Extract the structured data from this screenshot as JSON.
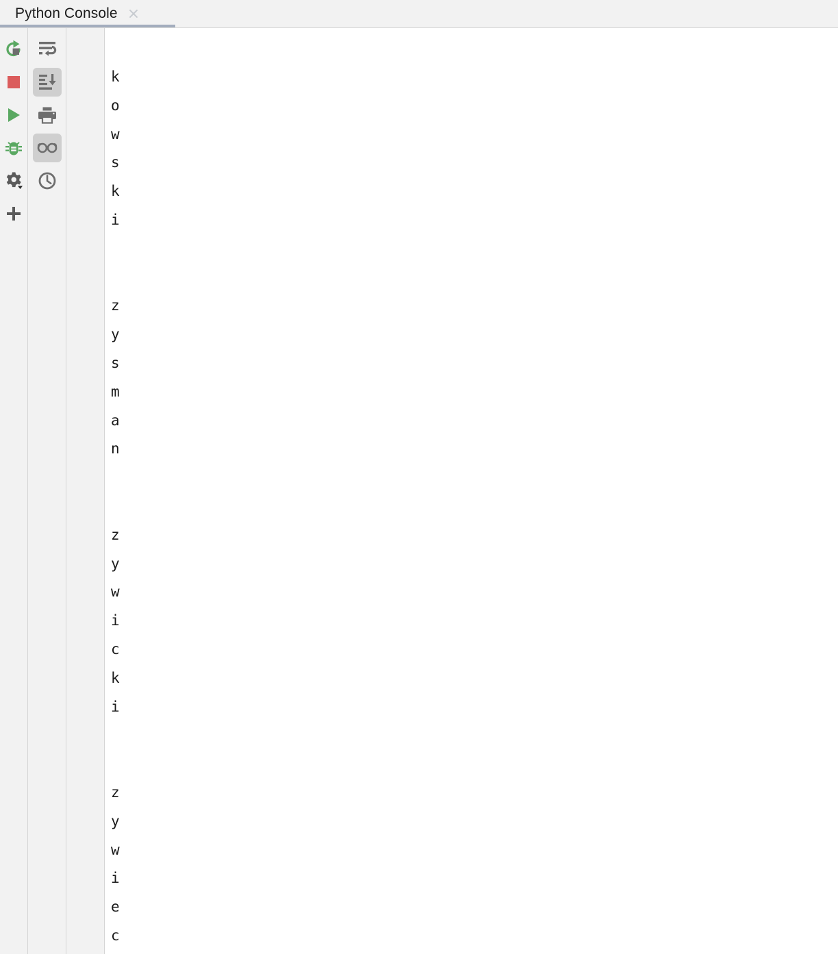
{
  "window": {
    "tab": {
      "title": "Python Console",
      "close_label": "×",
      "close_icon": "close-icon",
      "active": true,
      "underline_color": "#a3adbd"
    },
    "background": "#ffffff",
    "chrome_color": "#f2f2f2",
    "divider_color": "#d4d4d4"
  },
  "left_toolbar": {
    "buttons": [
      {
        "name": "rerun",
        "label": "Rerun Console",
        "icon": "rerun-icon",
        "color": "#59a861",
        "selected": false
      },
      {
        "name": "stop",
        "label": "Stop Console",
        "icon": "stop-square-icon",
        "color": "#db5c5c",
        "selected": false
      },
      {
        "name": "execute",
        "label": "Execute Current Statement",
        "icon": "play-triangle-icon",
        "color": "#59a861",
        "selected": false
      },
      {
        "name": "debug",
        "label": "Attach Debugger",
        "icon": "bug-icon",
        "color": "#59a861",
        "selected": false
      },
      {
        "name": "settings",
        "label": "Settings",
        "icon": "gear-icon",
        "color": "#5a5a5a",
        "selected": false
      },
      {
        "name": "new-console",
        "label": "New Console",
        "icon": "plus-icon",
        "color": "#5a5a5a",
        "selected": false
      }
    ]
  },
  "right_toolbar": {
    "buttons": [
      {
        "name": "soft-wrap",
        "label": "Use Soft Wraps",
        "icon": "soft-wrap-icon",
        "color": "#6e6e6e",
        "selected": false
      },
      {
        "name": "scroll-to-end",
        "label": "Scroll to the End",
        "icon": "scroll-to-end-icon",
        "color": "#6e6e6e",
        "selected": true
      },
      {
        "name": "print",
        "label": "Print",
        "icon": "printer-icon",
        "color": "#6e6e6e",
        "selected": false
      },
      {
        "name": "read-only",
        "label": "Toggle Read-Only Mode",
        "icon": "glasses-icon",
        "color": "#6e6e6e",
        "selected": true
      },
      {
        "name": "history",
        "label": "Show History",
        "icon": "clock-icon",
        "color": "#6e6e6e",
        "selected": false
      }
    ]
  },
  "console": {
    "output": "k\no\nw\ns\nk\ni\n\n\nz\ny\ns\nm\na\nn\n\n\nz\ny\nw\ni\nc\nk\ni\n\n\nz\ny\nw\ni\ne\nc\n"
  }
}
